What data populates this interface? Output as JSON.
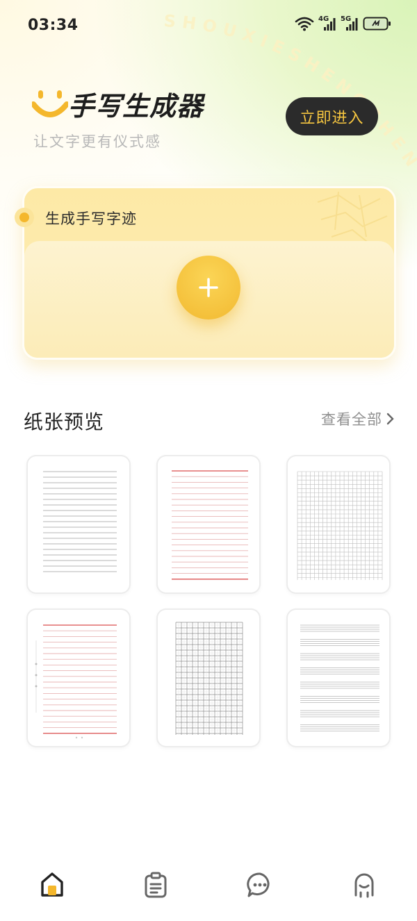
{
  "status_bar": {
    "time": "03:34",
    "network_4g": "4G",
    "network_5g": "5G"
  },
  "watermark_text": "SHOUXIESHENGCHENGQI",
  "hero": {
    "title": "手写生成器",
    "subtitle": "让文字更有仪式感",
    "enter_button": "立即进入"
  },
  "generate_card": {
    "label": "生成手写字迹"
  },
  "paper_section": {
    "title": "纸张预览",
    "view_all": "查看全部"
  },
  "papers": [
    {
      "style": "gray-lines"
    },
    {
      "style": "red-lines"
    },
    {
      "style": "square-grid"
    },
    {
      "style": "red-lines-margin"
    },
    {
      "style": "tian-grid"
    },
    {
      "style": "gray-grouped-lines"
    }
  ],
  "tabbar": {
    "items": [
      {
        "icon": "home-icon",
        "active": true
      },
      {
        "icon": "clipboard-icon",
        "active": false
      },
      {
        "icon": "chat-icon",
        "active": false
      },
      {
        "icon": "profile-icon",
        "active": false
      }
    ]
  },
  "colors": {
    "accent_yellow": "#f4b72c",
    "dark_button": "#2b2b2b",
    "red_line": "#e58a8a"
  }
}
